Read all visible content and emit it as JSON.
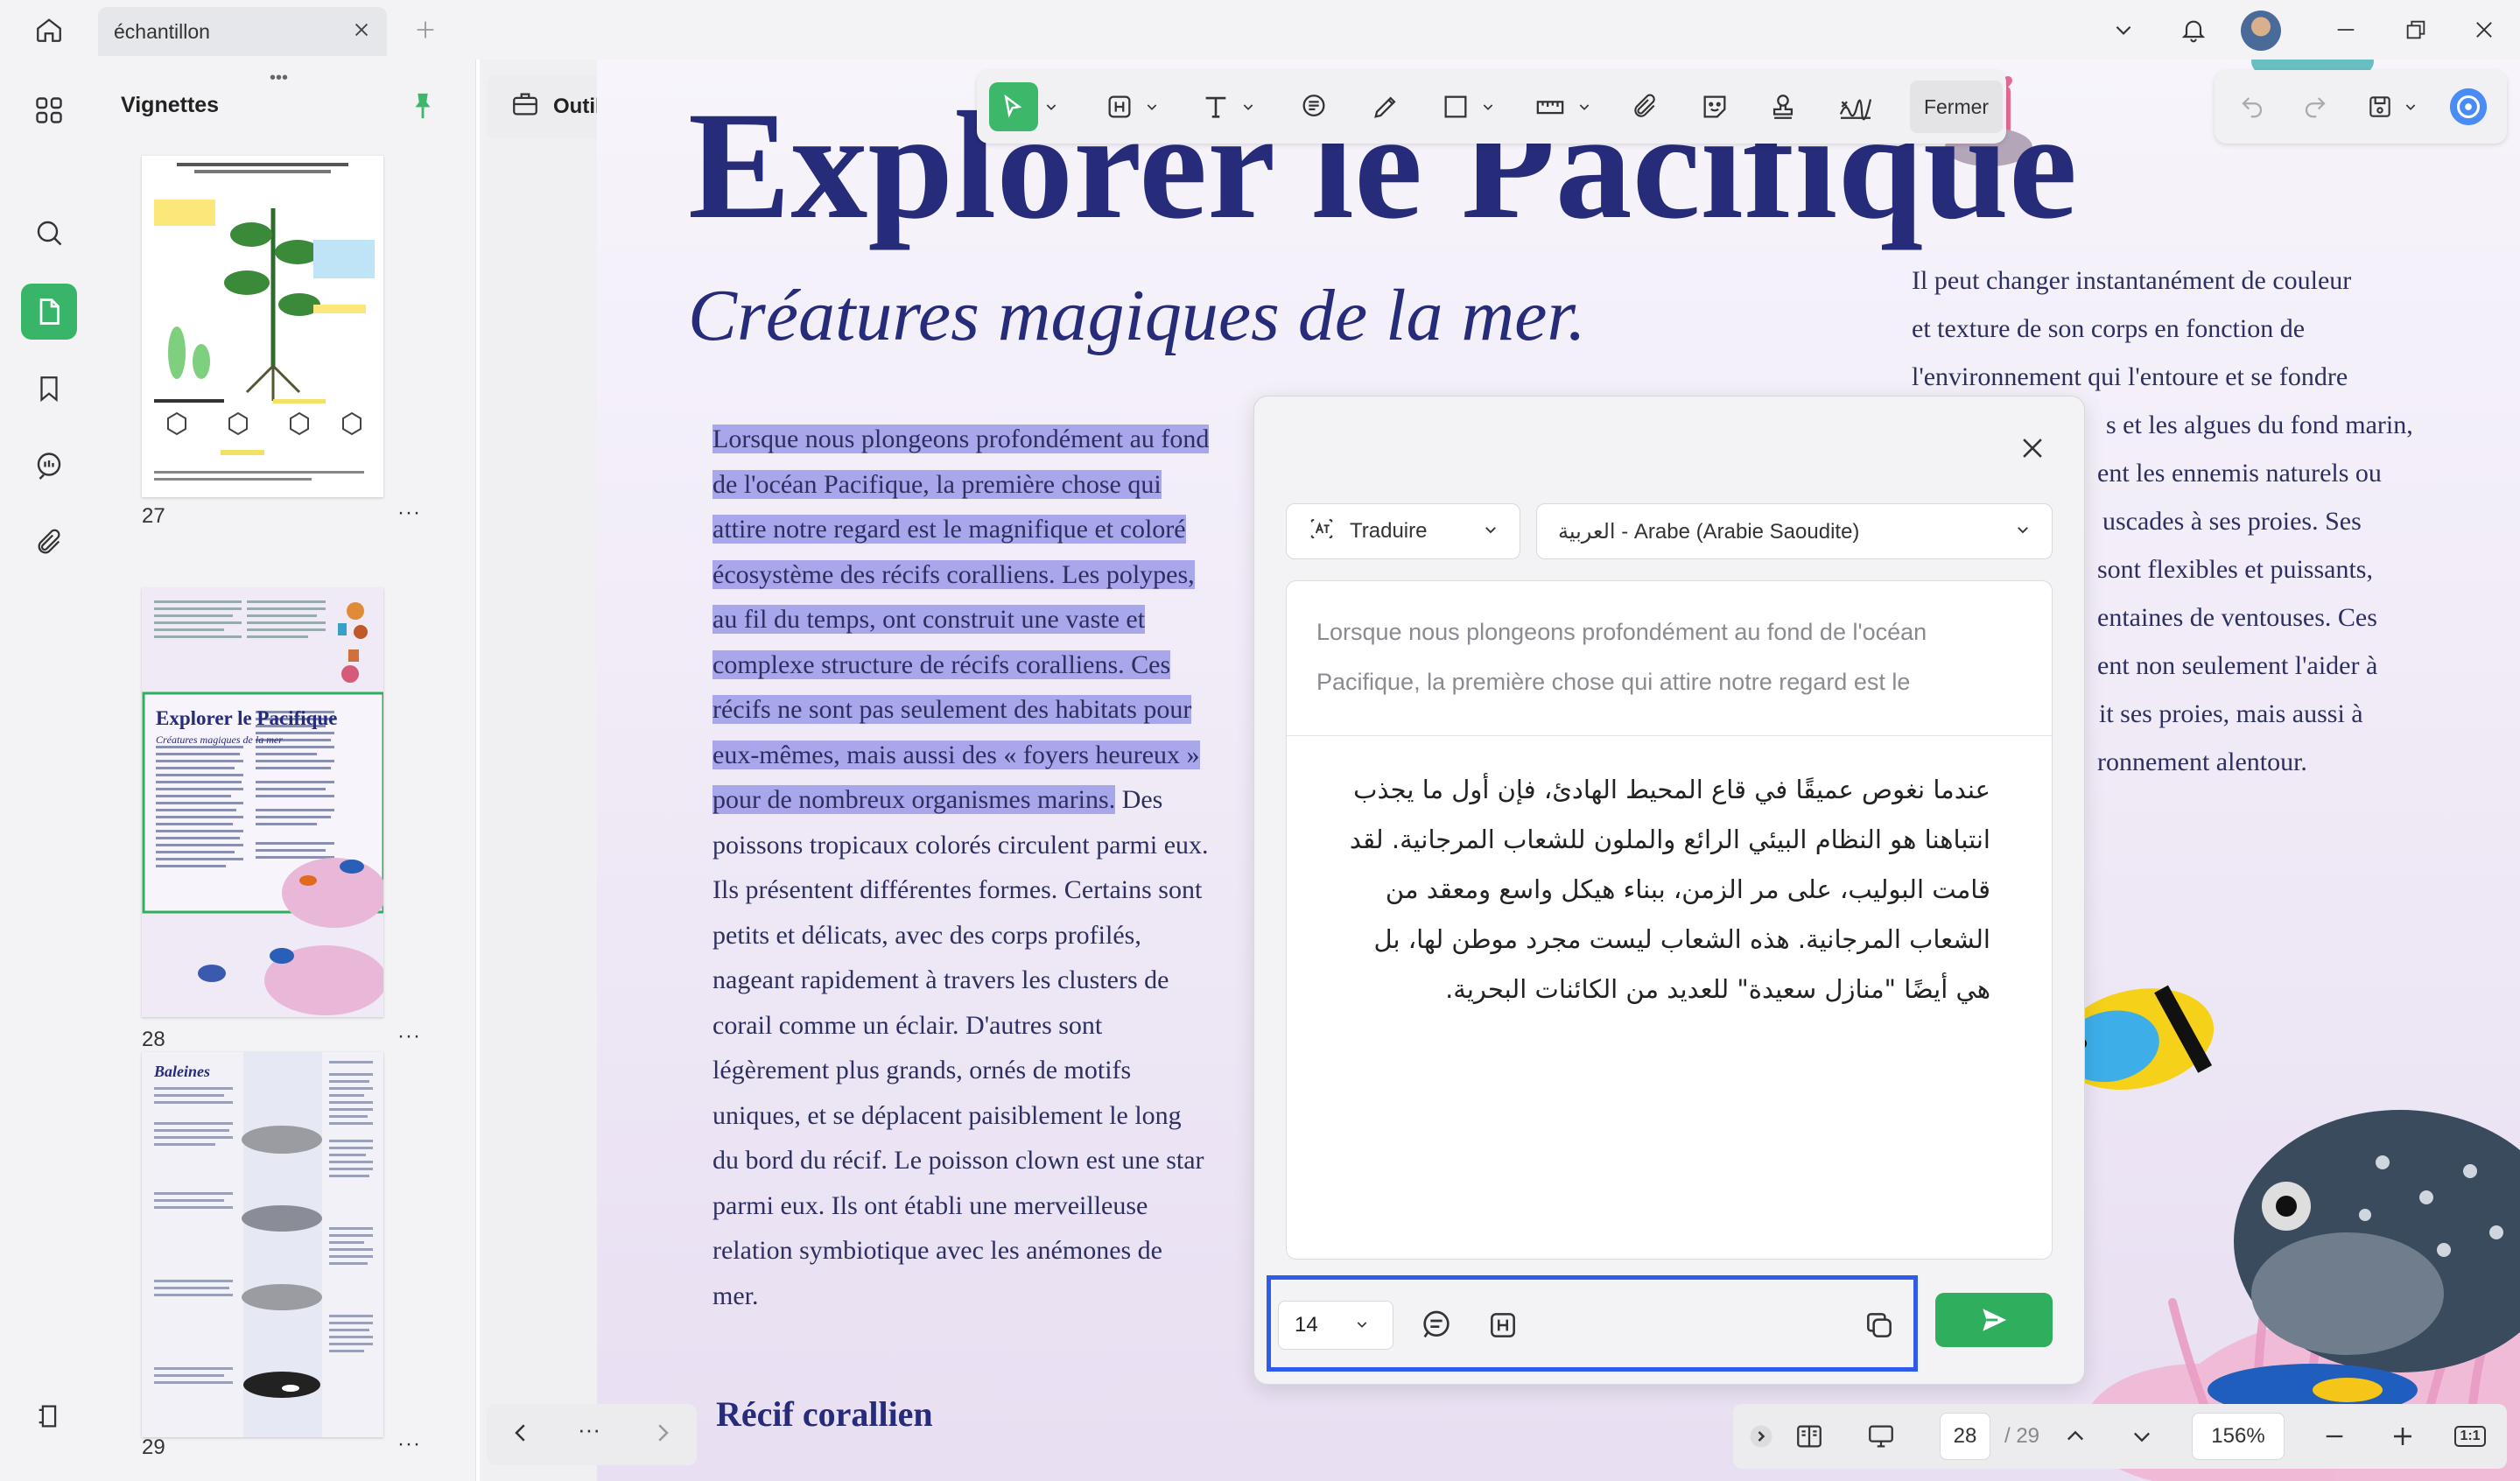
{
  "titlebar": {
    "tab_title": "échantillon",
    "icons": [
      "home-icon",
      "close-icon",
      "plus-icon",
      "chevron-down-icon",
      "bell-icon",
      "minimize-icon",
      "restore-icon",
      "close-window-icon"
    ]
  },
  "rail": {
    "icons": [
      "grid-icon",
      "search-icon",
      "page-icon",
      "bookmark-icon",
      "comment-icon",
      "attachment-icon",
      "layers-icon"
    ],
    "active": "page-icon"
  },
  "thumbnails": {
    "title": "Vignettes",
    "pages": [
      {
        "number": "27",
        "more": "···"
      },
      {
        "number": "28",
        "more": "···",
        "caption_title": "Explorer le Pacifique",
        "caption_subtitle": "Créatures magiques de la mer"
      },
      {
        "number": "29",
        "more": "···",
        "caption_title": "Baleines"
      }
    ]
  },
  "outils": {
    "label": "Outils"
  },
  "toolbar": {
    "close_label": "Fermer"
  },
  "document": {
    "title": "Explorer le Pacifique",
    "subtitle": "Créatures magiques de la mer.",
    "highlighted": "Lorsque nous plongeons profondément au fond de l'océan Pacifique, la première chose qui attire notre regard est le magnifique et coloré écosystème des récifs coralliens. Les polypes, au fil du temps, ont construit une vaste et complexe structure de récifs coralliens. Ces récifs ne sont pas seulement des habitats pour eux-mêmes, mais aussi des « foyers heureux » pour de nombreux organismes marins.",
    "body_rest": " Des poissons tropicaux colorés circulent parmi eux. Ils présentent différentes formes. Certains sont petits et délicats, avec des corps profilés, nageant rapidement à travers les clusters de corail comme un éclair. D'autres sont légèrement plus grands, ornés de motifs uniques, et se déplacent paisiblement le long du bord du récif. Le poisson clown est une star parmi eux. Ils ont établi une merveilleuse relation symbiotique avec les anémones de mer.",
    "section2": "Récif corallien",
    "right_lines": [
      "Il peut changer instantanément de couleur",
      "et texture de son corps en fonction de",
      "l'environnement qui l'entoure et se fondre",
      "s et les algues du fond marin,",
      "ent les ennemis naturels ou",
      "uscades à ses proies. Ses",
      "sont flexibles et puissants,",
      "entaines de ventouses. Ces",
      "ent non seulement l'aider à",
      "it ses proies, mais aussi à",
      "ronnement alentour."
    ]
  },
  "dialog": {
    "mode_label": "Traduire",
    "language_label": "العربية - Arabe (Arabie Saoudite)",
    "source_text": "Lorsque nous plongeons profondément au fond de l'océan Pacifique, la première chose qui attire notre regard est le",
    "translated_text": "عندما نغوص عميقًا في قاع المحيط الهادئ، فإن أول ما يجذب انتباهنا هو النظام البيئي الرائع والملون للشعاب المرجانية. لقد قامت البوليب، على مر الزمن، ببناء هيكل واسع ومعقد من الشعاب المرجانية. هذه الشعاب ليست مجرد موطن لها، بل هي أيضًا \"منازل سعيدة\" للعديد من الكائنات البحرية.",
    "font_size": "14"
  },
  "pagenav": {
    "more": "···"
  },
  "zoombar": {
    "current_page": "28",
    "total_pages": "/ 29",
    "zoom": "156%",
    "fit_label": "1:1"
  },
  "colors": {
    "accent": "#3db86a",
    "title_blue": "#262b7a",
    "highlight": "#a9a7ec",
    "focus_border": "#2f5bea"
  }
}
